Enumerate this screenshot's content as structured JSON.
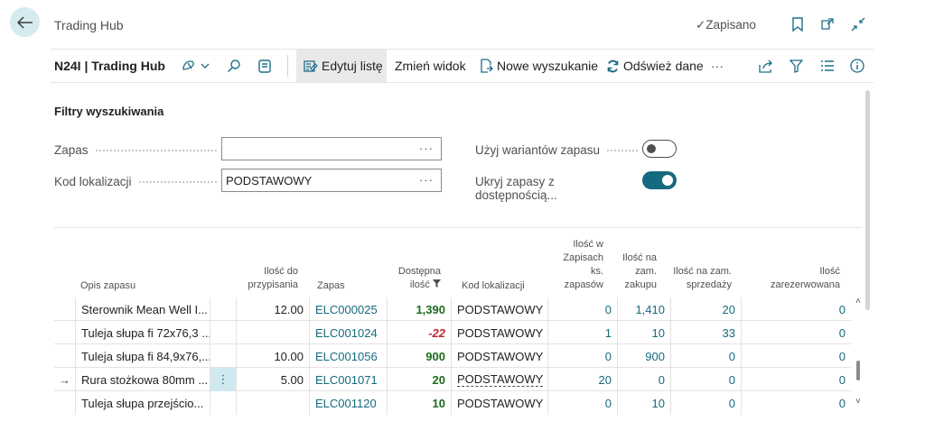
{
  "header": {
    "title": "Trading Hub",
    "saved_label": "Zapisano"
  },
  "toolbar": {
    "company": "N24I | Trading Hub",
    "edit_list": "Edytuj listę",
    "change_view": "Zmień widok",
    "new_search": "Nowe wyszukanie",
    "refresh": "Odśwież dane",
    "more": "···"
  },
  "filters": {
    "title": "Filtry wyszukiwania",
    "item_label": "Zapas",
    "item_value": "",
    "location_label": "Kod lokalizacji",
    "location_value": "PODSTAWOWY",
    "use_variants_label": "Użyj wariantów zapasu",
    "use_variants_on": false,
    "hide_items_label": "Ukryj zapasy z dostępnością...",
    "hide_items_on": true,
    "ellipsis": "···"
  },
  "table": {
    "headers": {
      "description": "Opis zapasu",
      "qty_to_assign": "Ilość do przypisania",
      "item": "Zapas",
      "available": "Dostępna ilość",
      "location": "Kod lokalizacji",
      "qty_in_books": "Ilość w Zapisach ks. zapasów",
      "qty_on_purchase": "Ilość na zam. zakupu",
      "qty_on_sales": "Ilość na zam. sprzedaży",
      "qty_reserved": "Ilość zarezerwowana"
    },
    "rows": [
      {
        "description": "Sterownik Mean Well I...",
        "qty_to_assign": "12.00",
        "item": "ELC000025",
        "available": "1,390",
        "location": "PODSTAWOWY",
        "qty_in_books": "0",
        "qty_on_purchase": "1,410",
        "qty_on_sales": "20",
        "qty_reserved": "0"
      },
      {
        "description": "Tuleja słupa fi 72x76,3 ...",
        "qty_to_assign": "",
        "item": "ELC001024",
        "available": "-22",
        "location": "PODSTAWOWY",
        "qty_in_books": "1",
        "qty_on_purchase": "10",
        "qty_on_sales": "33",
        "qty_reserved": "0"
      },
      {
        "description": "Tuleja słupa fi 84,9x76,...",
        "qty_to_assign": "10.00",
        "item": "ELC001056",
        "available": "900",
        "location": "PODSTAWOWY",
        "qty_in_books": "0",
        "qty_on_purchase": "900",
        "qty_on_sales": "0",
        "qty_reserved": "0"
      },
      {
        "description": "Rura stożkowa 80mm ...",
        "qty_to_assign": "5.00",
        "item": "ELC001071",
        "available": "20",
        "location": "PODSTAWOWY",
        "qty_in_books": "20",
        "qty_on_purchase": "0",
        "qty_on_sales": "0",
        "qty_reserved": "0"
      },
      {
        "description": "Tuleja słupa przejścio...",
        "qty_to_assign": "",
        "item": "ELC001120",
        "available": "10",
        "location": "PODSTAWOWY",
        "qty_in_books": "0",
        "qty_on_purchase": "10",
        "qty_on_sales": "0",
        "qty_reserved": "0"
      }
    ]
  },
  "colors": {
    "accent": "#156a7f",
    "positive": "#1b6b1b",
    "negative": "#c0272d"
  }
}
